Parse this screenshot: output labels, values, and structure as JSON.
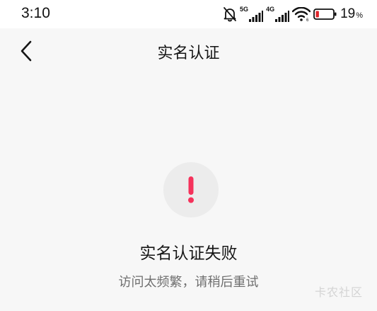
{
  "status_bar": {
    "time": "3:10",
    "network_1": "5G",
    "network_2": "4G",
    "battery_percent": "19",
    "battery_percent_symbol": "%",
    "battery_level": 0.19,
    "icons": [
      "bell-off-icon",
      "signal-icon",
      "signal-icon",
      "wifi-icon",
      "battery-icon"
    ],
    "colors": {
      "battery_low": "#e0242a"
    }
  },
  "header": {
    "back_icon": "chevron-left-icon",
    "title": "实名认证"
  },
  "result": {
    "icon": "exclamation-icon",
    "icon_color": "#f5325b",
    "title": "实名认证失败",
    "message": "访问太频繁，请稍后重试"
  },
  "watermark": "卡农社区"
}
